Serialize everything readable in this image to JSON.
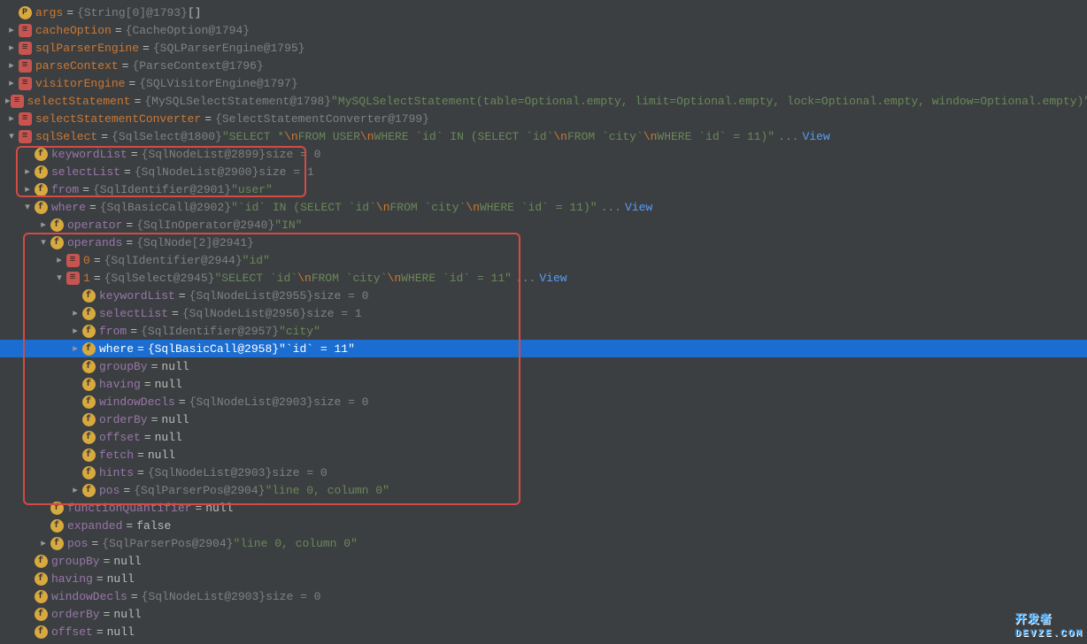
{
  "lines": [
    {
      "indent": 0,
      "arrow": "none",
      "icon": "p",
      "name": "args",
      "nameClass": "orange",
      "type": "{String[0]@1793}",
      "extra": " []"
    },
    {
      "indent": 0,
      "arrow": "closed",
      "icon": "e",
      "name": "cacheOption",
      "nameClass": "orange",
      "type": "{CacheOption@1794}"
    },
    {
      "indent": 0,
      "arrow": "closed",
      "icon": "e",
      "name": "sqlParserEngine",
      "nameClass": "orange",
      "type": "{SQLParserEngine@1795}"
    },
    {
      "indent": 0,
      "arrow": "closed",
      "icon": "e",
      "name": "parseContext",
      "nameClass": "orange",
      "type": "{ParseContext@1796}"
    },
    {
      "indent": 0,
      "arrow": "closed",
      "icon": "e",
      "name": "visitorEngine",
      "nameClass": "orange",
      "type": "{SQLVisitorEngine@1797}"
    },
    {
      "indent": 0,
      "arrow": "closed",
      "icon": "e",
      "name": "selectStatement",
      "nameClass": "orange",
      "type": "{MySQLSelectStatement@1798}",
      "str": "\"MySQLSelectStatement(table=Optional.empty, limit=Optional.empty, lock=Optional.empty, window=Optional.empty)\""
    },
    {
      "indent": 0,
      "arrow": "closed",
      "icon": "e",
      "name": "selectStatementConverter",
      "nameClass": "orange",
      "type": "{SelectStatementConverter@1799}"
    },
    {
      "indent": 0,
      "arrow": "open",
      "icon": "e",
      "name": "sqlSelect",
      "nameClass": "orange",
      "type": "{SqlSelect@1800}",
      "sqlstr": "\"SELECT *\\nFROM USER\\nWHERE `id` IN (SELECT `id`\\nFROM `city`\\nWHERE `id` = 11)\"",
      "viewlink": true
    },
    {
      "indent": 1,
      "arrow": "none",
      "icon": "f",
      "name": "keywordList",
      "type": "{SqlNodeList@2899}",
      "dim": "  size = 0"
    },
    {
      "indent": 1,
      "arrow": "closed",
      "icon": "f",
      "name": "selectList",
      "type": "{SqlNodeList@2900}",
      "dim": "  size = 1"
    },
    {
      "indent": 1,
      "arrow": "closed",
      "icon": "f",
      "name": "from",
      "type": "{SqlIdentifier@2901}",
      "str": "\"user\""
    },
    {
      "indent": 1,
      "arrow": "open",
      "icon": "f",
      "name": "where",
      "type": "{SqlBasicCall@2902}",
      "sqlstr": "\"`id` IN (SELECT `id`\\nFROM `city`\\nWHERE `id` = 11)\"",
      "viewlink": true
    },
    {
      "indent": 2,
      "arrow": "closed",
      "icon": "f",
      "name": "operator",
      "type": "{SqlInOperator@2940}",
      "str": "\"IN\""
    },
    {
      "indent": 2,
      "arrow": "open",
      "icon": "f",
      "name": "operands",
      "type": "{SqlNode[2]@2941}"
    },
    {
      "indent": 3,
      "arrow": "closed",
      "icon": "e",
      "name": "0",
      "nameClass": "orange",
      "type": "{SqlIdentifier@2944}",
      "str": "\"id\""
    },
    {
      "indent": 3,
      "arrow": "open",
      "icon": "e",
      "name": "1",
      "nameClass": "orange",
      "type": "{SqlSelect@2945}",
      "sqlstr": "\"SELECT `id`\\nFROM `city`\\nWHERE `id` = 11\"",
      "viewlink": true
    },
    {
      "indent": 4,
      "arrow": "none",
      "icon": "f",
      "name": "keywordList",
      "type": "{SqlNodeList@2955}",
      "dim": "  size = 0"
    },
    {
      "indent": 4,
      "arrow": "closed",
      "icon": "f",
      "name": "selectList",
      "type": "{SqlNodeList@2956}",
      "dim": "  size = 1"
    },
    {
      "indent": 4,
      "arrow": "closed",
      "icon": "f",
      "name": "from",
      "type": "{SqlIdentifier@2957}",
      "str": "\"city\""
    },
    {
      "indent": 4,
      "arrow": "closed",
      "icon": "f",
      "name": "where",
      "type": "{SqlBasicCall@2958}",
      "str": "\"`id` = 11\"",
      "selected": true
    },
    {
      "indent": 4,
      "arrow": "none",
      "icon": "f",
      "name": "groupBy",
      "extra": " null"
    },
    {
      "indent": 4,
      "arrow": "none",
      "icon": "f",
      "name": "having",
      "extra": " null"
    },
    {
      "indent": 4,
      "arrow": "none",
      "icon": "f",
      "name": "windowDecls",
      "type": "{SqlNodeList@2903}",
      "dim": "  size = 0"
    },
    {
      "indent": 4,
      "arrow": "none",
      "icon": "f",
      "name": "orderBy",
      "extra": " null"
    },
    {
      "indent": 4,
      "arrow": "none",
      "icon": "f",
      "name": "offset",
      "extra": " null"
    },
    {
      "indent": 4,
      "arrow": "none",
      "icon": "f",
      "name": "fetch",
      "extra": " null"
    },
    {
      "indent": 4,
      "arrow": "none",
      "icon": "f",
      "name": "hints",
      "type": "{SqlNodeList@2903}",
      "dim": "  size = 0"
    },
    {
      "indent": 4,
      "arrow": "closed",
      "icon": "f",
      "name": "pos",
      "type": "{SqlParserPos@2904}",
      "str": "\"line 0, column 0\""
    },
    {
      "indent": 2,
      "arrow": "none",
      "icon": "f",
      "name": "functionQuantifier",
      "extra": " null"
    },
    {
      "indent": 2,
      "arrow": "none",
      "icon": "f",
      "name": "expanded",
      "extra": " false"
    },
    {
      "indent": 2,
      "arrow": "closed",
      "icon": "f",
      "name": "pos",
      "type": "{SqlParserPos@2904}",
      "str": "\"line 0, column 0\""
    },
    {
      "indent": 1,
      "arrow": "none",
      "icon": "f",
      "name": "groupBy",
      "extra": " null"
    },
    {
      "indent": 1,
      "arrow": "none",
      "icon": "f",
      "name": "having",
      "extra": " null"
    },
    {
      "indent": 1,
      "arrow": "none",
      "icon": "f",
      "name": "windowDecls",
      "type": "{SqlNodeList@2903}",
      "dim": "  size = 0"
    },
    {
      "indent": 1,
      "arrow": "none",
      "icon": "f",
      "name": "orderBy",
      "extra": " null"
    },
    {
      "indent": 1,
      "arrow": "none",
      "icon": "f",
      "name": "offset",
      "extra": " null"
    }
  ],
  "viewLabel": "View",
  "watermark": {
    "main": "开发者",
    "sub": "DEVZE.COM"
  }
}
